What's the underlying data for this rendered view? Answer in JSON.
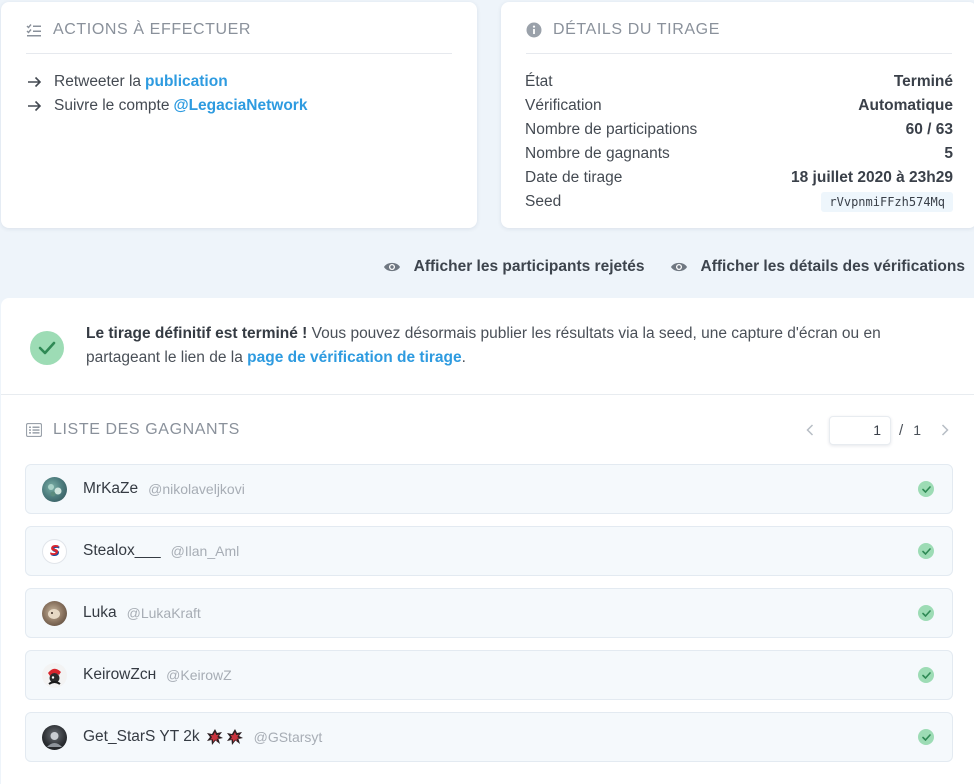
{
  "actions": {
    "title": "ACTIONS À EFFECTUER",
    "items": [
      {
        "text": "Retweeter la",
        "link": "publication"
      },
      {
        "text": "Suivre le compte",
        "link": "@LegaciaNetwork"
      }
    ]
  },
  "details": {
    "title": "DÉTAILS DU TIRAGE",
    "rows": [
      {
        "label": "État",
        "value": "Terminé"
      },
      {
        "label": "Vérification",
        "value": "Automatique"
      },
      {
        "label": "Nombre de participations",
        "value": "60 / 63"
      },
      {
        "label": "Nombre de gagnants",
        "value": "5"
      },
      {
        "label": "Date de tirage",
        "value": "18 juillet 2020 à 23h29"
      },
      {
        "label": "Seed",
        "value": "rVvpnmiFFzh574Mq"
      }
    ]
  },
  "toggles": {
    "rejected": "Afficher les participants rejetés",
    "verifications": "Afficher les détails des vérifications"
  },
  "success": {
    "strong": "Le tirage définitif est terminé !",
    "text": " Vous pouvez désormais publier les résultats via la seed, une capture d'écran ou en partageant le lien de la ",
    "link": "page de vérification de tirage",
    "end": "."
  },
  "winners": {
    "title": "LISTE DES GAGNANTS",
    "page": "1",
    "page_sep": "/",
    "page_total": "1",
    "items": [
      {
        "name": "MrKaZe",
        "handle": "@nikolaveljkovi"
      },
      {
        "name": "Stealox___",
        "handle": "@Ilan_Aml",
        "avatar_letter": "S"
      },
      {
        "name": "Luka",
        "handle": "@LukaKraft"
      },
      {
        "name": "KeirowZᴄʜ",
        "handle": "@KeirowZ"
      },
      {
        "name": "Get_StarS YT 2k",
        "handle": "@GStarsyt"
      }
    ]
  },
  "colors": {
    "accent": "#2e9be0",
    "success": "#9ddcb5",
    "background": "#eef4fa"
  }
}
